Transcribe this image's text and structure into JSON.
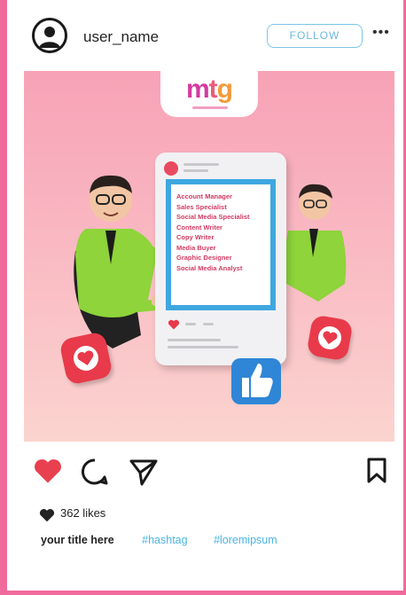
{
  "header": {
    "username": "user_name",
    "follow_label": "FOLLOW",
    "more_label": "•••"
  },
  "post": {
    "logo": {
      "m": "m",
      "t": "t",
      "g": "g"
    },
    "job_list": [
      "Account Manager",
      "Sales Specialist",
      "Social Media Specialist",
      "Content Writer",
      "Copy Writer",
      "Media Buyer",
      "Graphic Designer",
      "Social Media Analyst"
    ]
  },
  "actions": {
    "like_icon": "heart-filled-icon",
    "comment_icon": "comment-icon",
    "share_icon": "send-icon",
    "save_icon": "bookmark-icon"
  },
  "likes": {
    "count_text": "362 likes"
  },
  "caption": {
    "title": "your title here",
    "hashtags": [
      "#hashtag",
      "#loremipsum"
    ]
  },
  "colors": {
    "frame": "#f06a9b",
    "like": "#e8404f",
    "follow": "#6bb8dc",
    "hashtag": "#4bb3e6"
  }
}
